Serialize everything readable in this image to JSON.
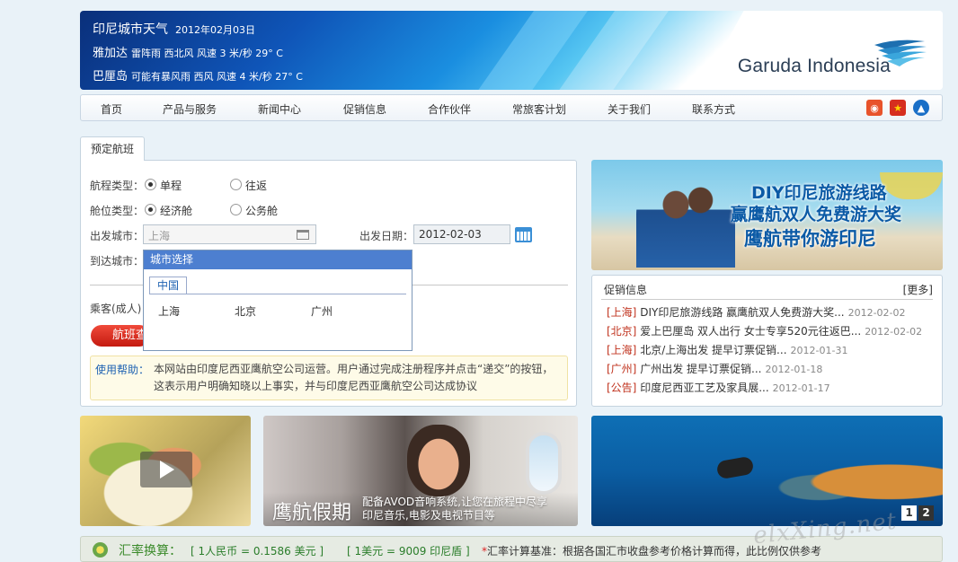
{
  "header": {
    "weather_title": "印尼城市天气",
    "weather_date": "2012年02月03日",
    "rows": [
      {
        "city": "雅加达",
        "detail": "雷阵雨 西北风 风速 3 米/秒 29° C"
      },
      {
        "city": "巴厘岛",
        "detail": "可能有暴风雨 西风 风速 4 米/秒 27° C"
      }
    ],
    "logo_text": "Garuda Indonesia"
  },
  "nav": {
    "items": [
      "首页",
      "产品与服务",
      "新闻中心",
      "促销信息",
      "合作伙伴",
      "常旅客计划",
      "关于我们",
      "联系方式"
    ],
    "icons": [
      "weibo-icon",
      "star-icon",
      "a-icon"
    ]
  },
  "booking": {
    "tab": "预定航班",
    "trip_type_label": "航程类型：",
    "trip_options": [
      "单程",
      "往返"
    ],
    "trip_selected": "单程",
    "cabin_label": "舱位类型：",
    "cabin_options": [
      "经济舱",
      "公务舱"
    ],
    "cabin_selected": "经济舱",
    "depart_city_label": "出发城市：",
    "depart_city_value": "上海",
    "depart_date_label": "出发日期：",
    "depart_date_value": "2012-02-03",
    "arrive_city_label": "到达城市：",
    "passenger_label": "乘客(成人)",
    "search_button": "航班查询",
    "help_title": "使用帮助：",
    "help_text": "本网站由印度尼西亚鹰航空公司运营。用户通过完成注册程序并点击“递交”的按钮，这表示用户明确知晓以上事实，并与印度尼西亚鹰航空公司达成协议"
  },
  "city_dropdown": {
    "header": "城市选择",
    "tab": "中国",
    "cities": [
      "上海",
      "北京",
      "广州"
    ]
  },
  "promo_banner": {
    "line1": "DIY印尼旅游线路",
    "line2": "赢鹰航双人免费游大奖",
    "line3": "鹰航带你游印尼"
  },
  "news": {
    "title": "促销信息",
    "more": "[更多]",
    "items": [
      {
        "tag": "[上海]",
        "text": "DIY印尼旅游线路 赢鹰航双人免费游大奖...",
        "date": "2012-02-02"
      },
      {
        "tag": "[北京]",
        "text": "爱上巴厘岛 双人出行 女士专享520元往返巴...",
        "date": "2012-02-02"
      },
      {
        "tag": "[上海]",
        "text": "北京/上海出发 提早订票促销...",
        "date": "2012-01-31"
      },
      {
        "tag": "[广州]",
        "text": "广州出发 提早订票促销...",
        "date": "2012-01-18"
      },
      {
        "tag": "[公告]",
        "text": "印度尼西亚工艺及家具展...",
        "date": "2012-01-17"
      }
    ]
  },
  "av_banner": {
    "big": "鹰航假期",
    "line1": "配备AVOD音响系统,让您在旅程中尽享",
    "line2": "印尼音乐,电影及电视节目等"
  },
  "sea_pager": [
    "1",
    "2"
  ],
  "exchange": {
    "title": "汇率换算：",
    "rate1": "[ 1人民币 = 0.1586 美元 ]",
    "rate2": "[ 1美元 = 9009 印尼盾 ]",
    "note_mark": "*",
    "note": "汇率计算基准：根据各国汇市收盘参考价格计算而得，此比例仅供参考"
  },
  "watermark": "elxXing.net"
}
